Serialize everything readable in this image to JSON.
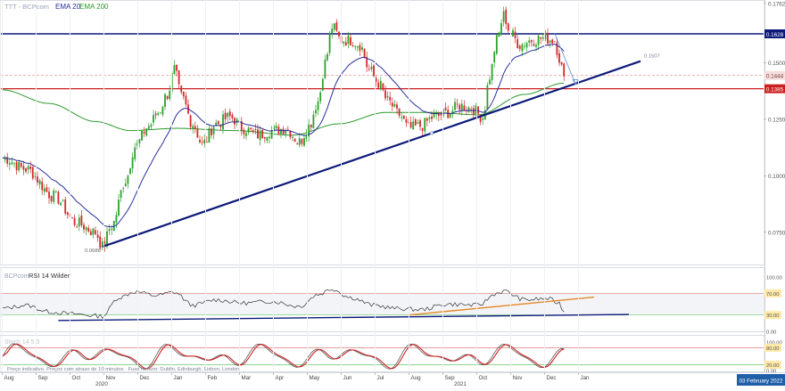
{
  "header": {
    "symbol_label": "TTT - BCPcom",
    "ema20_label": "EMA 20",
    "ema200_label": "EMA 200"
  },
  "rsi_panel": {
    "source_label": "BCPcom",
    "title": "RSI 14 Wilder",
    "ticks": [
      "100.00",
      "70.00",
      "30.00",
      "0.00"
    ]
  },
  "stoch_panel": {
    "title": "Stoch 14 5 3",
    "ticks": [
      "100.00",
      "80.00",
      "20.00",
      "0.00"
    ]
  },
  "footer_note": "Preço indicativo. Preços com atraso de 10 minutos · Fuso horário: Dublin, Edinburgh, Lisbon, London",
  "date_badge": "03 February 2022",
  "colors": {
    "ema20": "#2a2f9c",
    "ema200": "#2f9a2f",
    "up": "#2ca02c",
    "down": "#d62728",
    "trendline": "#0d1a7a",
    "resistance": "#0d1a7a",
    "support": "#cc1f1f",
    "rsi_trend": "#e58a2c",
    "stoch_k": "#444444",
    "stoch_d": "#cc2222",
    "badge_bg": "#1f5fa8"
  },
  "chart_data": {
    "type": "candlestick",
    "title": "",
    "ylim": [
      0.0623,
      0.1762
    ],
    "y_ticks": [
      "0.1762",
      "0.1500",
      "0.1250",
      "0.1000",
      "0.0750"
    ],
    "levels": [
      {
        "label": "0.1628",
        "value": 0.1628,
        "style": "resistance"
      },
      {
        "label": "0.1444",
        "value": 0.1444,
        "style": "dashed"
      },
      {
        "label": "0.1385",
        "value": 0.1385,
        "style": "support"
      }
    ],
    "low_label": {
      "label": "0.0686",
      "value": 0.0686
    },
    "side_value_label": {
      "label": "0.1507",
      "value": 0.1507
    },
    "months": [
      "Aug",
      "Sep",
      "Oct",
      "Nov",
      "Dec",
      "Jan",
      "Feb",
      "Mar",
      "Apr",
      "May",
      "Jun",
      "Jul",
      "Aug",
      "Sep",
      "Oct",
      "Nov",
      "Dec",
      "Jan"
    ],
    "years": [
      "2020",
      "2021"
    ],
    "anchors": [
      {
        "i": 0,
        "v": 0.108
      },
      {
        "i": 10,
        "v": 0.103
      },
      {
        "i": 22,
        "v": 0.091
      },
      {
        "i": 32,
        "v": 0.079
      },
      {
        "i": 40,
        "v": 0.075
      },
      {
        "i": 43,
        "v": 0.0686
      },
      {
        "i": 47,
        "v": 0.078
      },
      {
        "i": 53,
        "v": 0.098
      },
      {
        "i": 57,
        "v": 0.113
      },
      {
        "i": 63,
        "v": 0.122
      },
      {
        "i": 67,
        "v": 0.128
      },
      {
        "i": 71,
        "v": 0.136
      },
      {
        "i": 74,
        "v": 0.147
      },
      {
        "i": 77,
        "v": 0.135
      },
      {
        "i": 82,
        "v": 0.123
      },
      {
        "i": 86,
        "v": 0.114
      },
      {
        "i": 92,
        "v": 0.123
      },
      {
        "i": 98,
        "v": 0.126
      },
      {
        "i": 104,
        "v": 0.121
      },
      {
        "i": 110,
        "v": 0.118
      },
      {
        "i": 116,
        "v": 0.12
      },
      {
        "i": 122,
        "v": 0.121
      },
      {
        "i": 128,
        "v": 0.115
      },
      {
        "i": 132,
        "v": 0.122
      },
      {
        "i": 136,
        "v": 0.133
      },
      {
        "i": 139,
        "v": 0.15
      },
      {
        "i": 142,
        "v": 0.166
      },
      {
        "i": 146,
        "v": 0.16
      },
      {
        "i": 150,
        "v": 0.16
      },
      {
        "i": 154,
        "v": 0.158
      },
      {
        "i": 158,
        "v": 0.147
      },
      {
        "i": 162,
        "v": 0.141
      },
      {
        "i": 166,
        "v": 0.133
      },
      {
        "i": 171,
        "v": 0.127
      },
      {
        "i": 175,
        "v": 0.121
      },
      {
        "i": 180,
        "v": 0.122
      },
      {
        "i": 186,
        "v": 0.126
      },
      {
        "i": 192,
        "v": 0.128
      },
      {
        "i": 197,
        "v": 0.131
      },
      {
        "i": 202,
        "v": 0.13
      },
      {
        "i": 207,
        "v": 0.126
      },
      {
        "i": 210,
        "v": 0.144
      },
      {
        "i": 213,
        "v": 0.16
      },
      {
        "i": 216,
        "v": 0.171
      },
      {
        "i": 219,
        "v": 0.163
      },
      {
        "i": 223,
        "v": 0.158
      },
      {
        "i": 228,
        "v": 0.16
      },
      {
        "i": 233,
        "v": 0.161
      },
      {
        "i": 238,
        "v": 0.16
      },
      {
        "i": 240,
        "v": 0.152
      },
      {
        "i": 242,
        "v": 0.144
      }
    ],
    "ema200_anchors": [
      {
        "i": 0,
        "v": 0.138
      },
      {
        "i": 20,
        "v": 0.132
      },
      {
        "i": 40,
        "v": 0.124
      },
      {
        "i": 55,
        "v": 0.12
      },
      {
        "i": 75,
        "v": 0.121
      },
      {
        "i": 100,
        "v": 0.12
      },
      {
        "i": 125,
        "v": 0.118
      },
      {
        "i": 145,
        "v": 0.123
      },
      {
        "i": 165,
        "v": 0.128
      },
      {
        "i": 185,
        "v": 0.128
      },
      {
        "i": 205,
        "v": 0.127
      },
      {
        "i": 225,
        "v": 0.136
      },
      {
        "i": 242,
        "v": 0.141
      }
    ],
    "trendline": {
      "from": {
        "i": 43,
        "v": 0.0686
      },
      "to": {
        "i": 275,
        "v": 0.1507
      }
    },
    "rsi": {
      "ylim": [
        0,
        100
      ],
      "levels": [
        70,
        30
      ],
      "anchors": [
        {
          "i": 0,
          "v": 42
        },
        {
          "i": 10,
          "v": 48
        },
        {
          "i": 20,
          "v": 36
        },
        {
          "i": 30,
          "v": 32
        },
        {
          "i": 43,
          "v": 28
        },
        {
          "i": 50,
          "v": 62
        },
        {
          "i": 57,
          "v": 73
        },
        {
          "i": 66,
          "v": 66
        },
        {
          "i": 74,
          "v": 72
        },
        {
          "i": 82,
          "v": 48
        },
        {
          "i": 92,
          "v": 58
        },
        {
          "i": 104,
          "v": 52
        },
        {
          "i": 116,
          "v": 55
        },
        {
          "i": 128,
          "v": 46
        },
        {
          "i": 136,
          "v": 68
        },
        {
          "i": 142,
          "v": 78
        },
        {
          "i": 150,
          "v": 62
        },
        {
          "i": 160,
          "v": 48
        },
        {
          "i": 170,
          "v": 42
        },
        {
          "i": 180,
          "v": 40
        },
        {
          "i": 192,
          "v": 50
        },
        {
          "i": 205,
          "v": 48
        },
        {
          "i": 213,
          "v": 70
        },
        {
          "i": 216,
          "v": 74
        },
        {
          "i": 225,
          "v": 58
        },
        {
          "i": 235,
          "v": 60
        },
        {
          "i": 240,
          "v": 52
        },
        {
          "i": 242,
          "v": 36
        }
      ],
      "trend_orange": {
        "from": {
          "i": 175,
          "v": 30
        },
        "to": {
          "i": 255,
          "v": 63
        }
      },
      "trend_navy": {
        "from": {
          "i": 24,
          "v": 20
        },
        "to": {
          "i": 270,
          "v": 31
        }
      }
    },
    "stoch": {
      "ylim": [
        0,
        100
      ],
      "levels": [
        80,
        20
      ]
    }
  }
}
